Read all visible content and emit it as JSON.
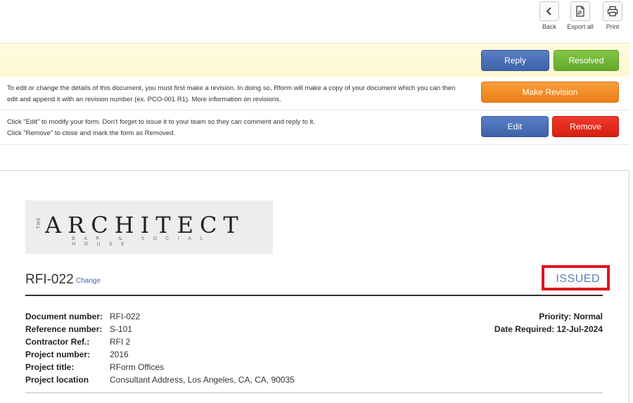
{
  "toolbar": {
    "back_label": "Back",
    "back_icon": "chevron-left-icon",
    "export_label": "Export all",
    "export_icon": "export-pdf-icon",
    "print_label": "Print",
    "print_icon": "printer-icon"
  },
  "actions": {
    "reply_label": "Reply",
    "resolved_label": "Resolved",
    "revision_text": "To edit or change the details of this document, you must first make a revision. In doing so, Rform will make a copy of your document which you can then edit and append it with an revision number (ex. PCO-001 R1). More information on revisions.",
    "make_revision_label": "Make Revision",
    "edit_text_1": "Click \"Edit\" to modify your form. Don't forget to issue it to your team so they can comment and reply to it.",
    "edit_text_2": "Click \"Remove\" to close and mark the form as Removed.",
    "edit_label": "Edit",
    "remove_label": "Remove",
    "colors": {
      "blue": "#4a6fb5",
      "green": "#72b637",
      "orange": "#f28d22",
      "red": "#e42a1d"
    }
  },
  "document": {
    "logo": {
      "the": "THE",
      "word": "ARCHITECT",
      "tagline": "BAR & SOCIAL HOUSE"
    },
    "title": "RFI-022",
    "change_link": "Change",
    "status": "ISSUED",
    "status_border_color": "#e0141e",
    "fields": [
      {
        "label": "Document number:",
        "value": "RFI-022"
      },
      {
        "label": "Reference number:",
        "value": "S-101"
      },
      {
        "label": "Contractor Ref.:",
        "value": "RFI 2"
      },
      {
        "label": "Project number:",
        "value": "2016"
      },
      {
        "label": "Project title:",
        "value": "RForm Offices"
      },
      {
        "label": "Project location",
        "value": "Consultant Address, Los Angeles, CA, CA, 90035"
      }
    ],
    "priority_label": "Priority:",
    "priority_value": "Normal",
    "date_required_label": "Date Required:",
    "date_required_value": "12-Jul-2024"
  }
}
